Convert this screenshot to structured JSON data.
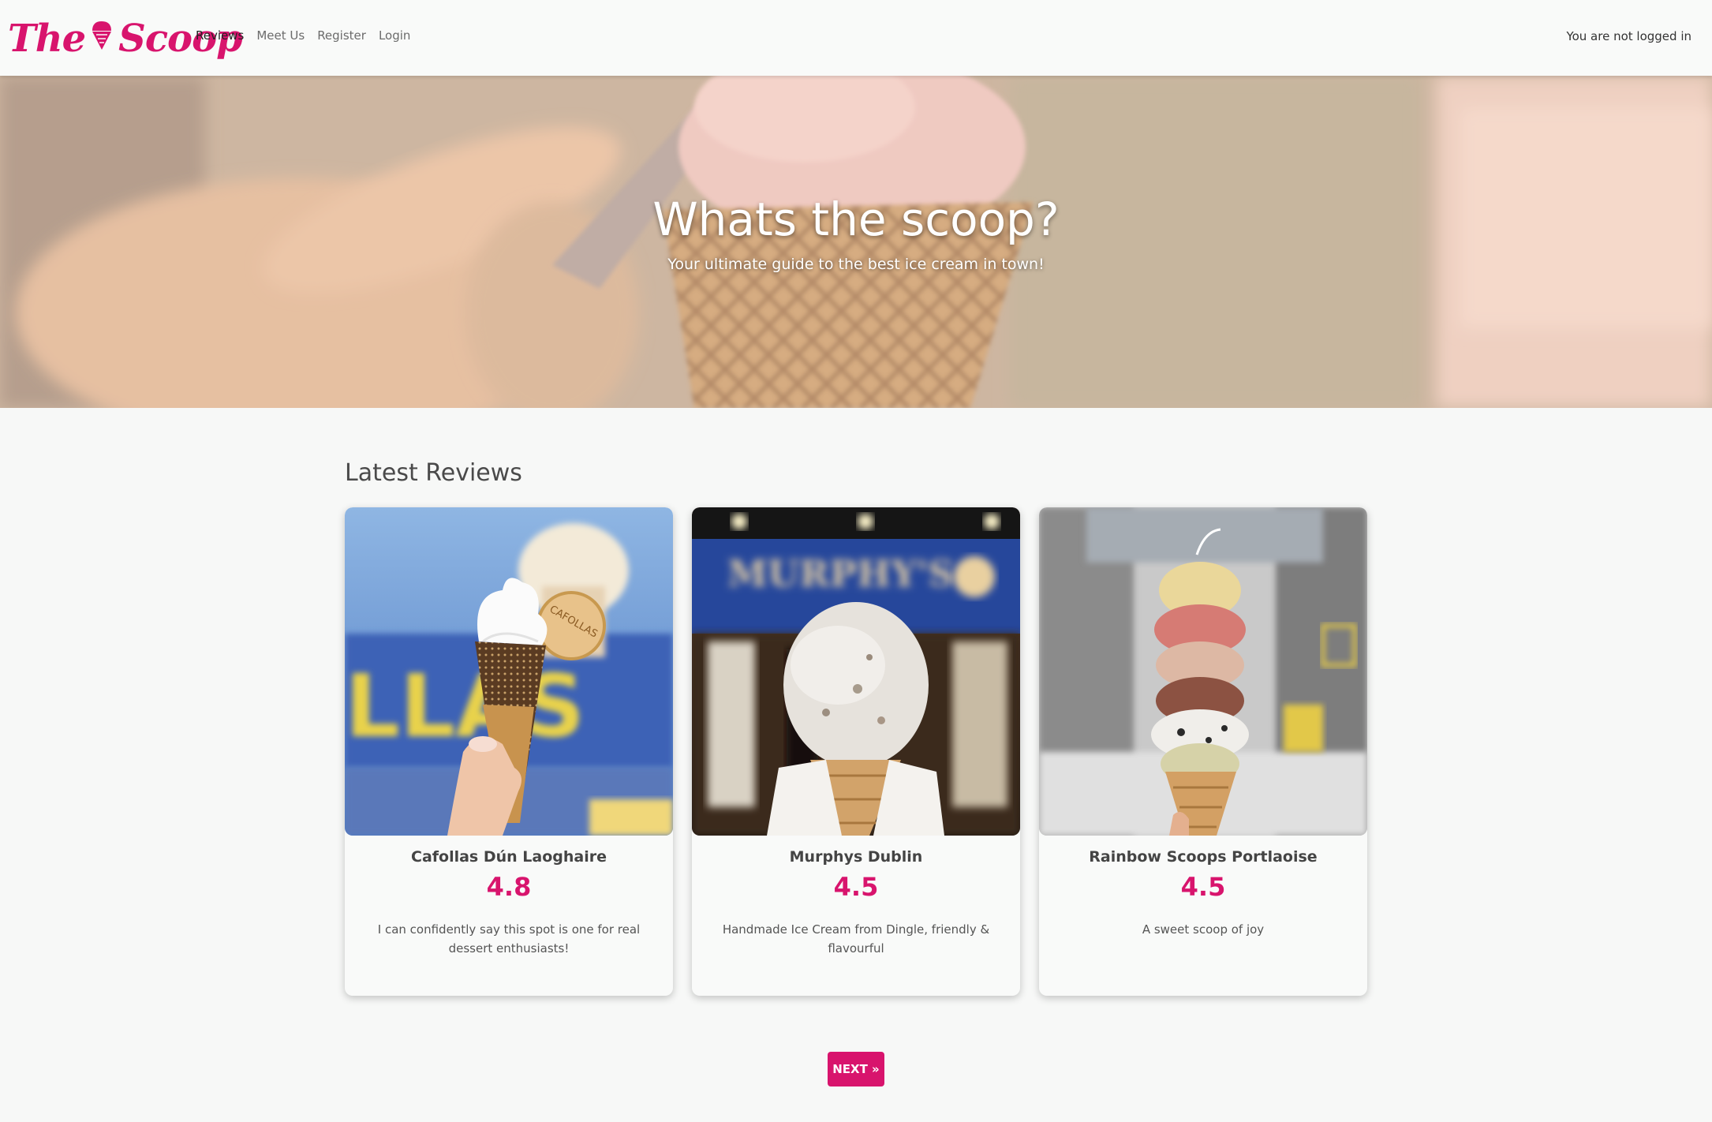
{
  "brand": {
    "name_left": "The",
    "name_right": "Scoop",
    "color": "#d8146d"
  },
  "nav": {
    "items": [
      {
        "label": "Reviews",
        "active": true
      },
      {
        "label": "Meet Us",
        "active": false
      },
      {
        "label": "Register",
        "active": false
      },
      {
        "label": "Login",
        "active": false
      }
    ],
    "status": "You are not logged in"
  },
  "hero": {
    "title": "Whats the scoop?",
    "subtitle": "Your ultimate guide to the best ice cream in town!"
  },
  "reviews_section": {
    "heading": "Latest Reviews",
    "cards": [
      {
        "venue": "Cafollas Dún Laoghaire",
        "rating": "4.8",
        "excerpt": "I can confidently say this spot is one for real dessert enthusiasts!"
      },
      {
        "venue": "Murphys Dublin",
        "rating": "4.5",
        "excerpt": "Handmade Ice Cream from Dingle, friendly & flavourful"
      },
      {
        "venue": "Rainbow Scoops Portlaoise",
        "rating": "4.5",
        "excerpt": "A sweet scoop of joy"
      }
    ]
  },
  "pagination": {
    "next_label": "NEXT »"
  },
  "image_text": {
    "card1_sign": "LLAS",
    "card1_wafer": "CAFOLLAS",
    "card2_sign": "MURPHY'S"
  },
  "colors": {
    "accent": "#d8146d",
    "background": "#f7f8f7",
    "navbar": "#f9faf9"
  }
}
